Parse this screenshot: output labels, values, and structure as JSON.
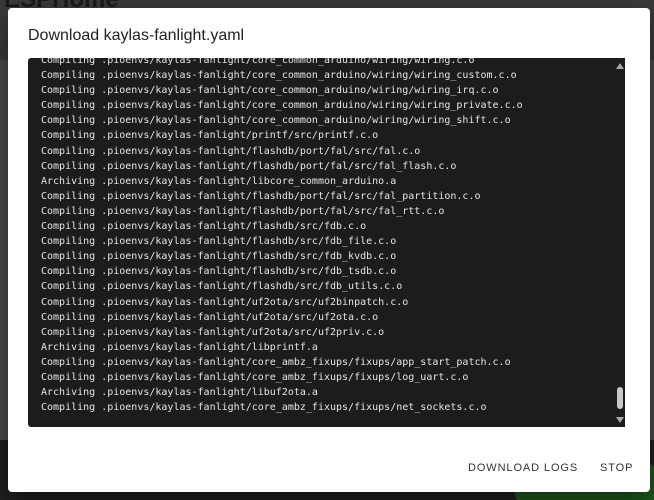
{
  "background": {
    "app_title": "ESPHome"
  },
  "dialog": {
    "title": "Download kaylas-fanlight.yaml",
    "log_lines": [
      "Compiling .pioenvs/kaylas-fanlight/core_common_arduino/wiring/wiring.c.o",
      "Compiling .pioenvs/kaylas-fanlight/core_common_arduino/wiring/wiring_custom.c.o",
      "Compiling .pioenvs/kaylas-fanlight/core_common_arduino/wiring/wiring_irq.c.o",
      "Compiling .pioenvs/kaylas-fanlight/core_common_arduino/wiring/wiring_private.c.o",
      "Compiling .pioenvs/kaylas-fanlight/core_common_arduino/wiring/wiring_shift.c.o",
      "Compiling .pioenvs/kaylas-fanlight/printf/src/printf.c.o",
      "Compiling .pioenvs/kaylas-fanlight/flashdb/port/fal/src/fal.c.o",
      "Compiling .pioenvs/kaylas-fanlight/flashdb/port/fal/src/fal_flash.c.o",
      "Archiving .pioenvs/kaylas-fanlight/libcore_common_arduino.a",
      "Compiling .pioenvs/kaylas-fanlight/flashdb/port/fal/src/fal_partition.c.o",
      "Compiling .pioenvs/kaylas-fanlight/flashdb/port/fal/src/fal_rtt.c.o",
      "Compiling .pioenvs/kaylas-fanlight/flashdb/src/fdb.c.o",
      "Compiling .pioenvs/kaylas-fanlight/flashdb/src/fdb_file.c.o",
      "Compiling .pioenvs/kaylas-fanlight/flashdb/src/fdb_kvdb.c.o",
      "Compiling .pioenvs/kaylas-fanlight/flashdb/src/fdb_tsdb.c.o",
      "Compiling .pioenvs/kaylas-fanlight/flashdb/src/fdb_utils.c.o",
      "Compiling .pioenvs/kaylas-fanlight/uf2ota/src/uf2binpatch.c.o",
      "Compiling .pioenvs/kaylas-fanlight/uf2ota/src/uf2ota.c.o",
      "Compiling .pioenvs/kaylas-fanlight/uf2ota/src/uf2priv.c.o",
      "Archiving .pioenvs/kaylas-fanlight/libprintf.a",
      "Compiling .pioenvs/kaylas-fanlight/core_ambz_fixups/fixups/app_start_patch.c.o",
      "Compiling .pioenvs/kaylas-fanlight/core_ambz_fixups/fixups/log_uart.c.o",
      "Archiving .pioenvs/kaylas-fanlight/libuf2ota.a",
      "Compiling .pioenvs/kaylas-fanlight/core_ambz_fixups/fixups/net_sockets.c.o"
    ],
    "scroll_position": 0.95,
    "actions": {
      "download_logs_label": "DOWNLOAD LOGS",
      "stop_label": "STOP"
    }
  }
}
